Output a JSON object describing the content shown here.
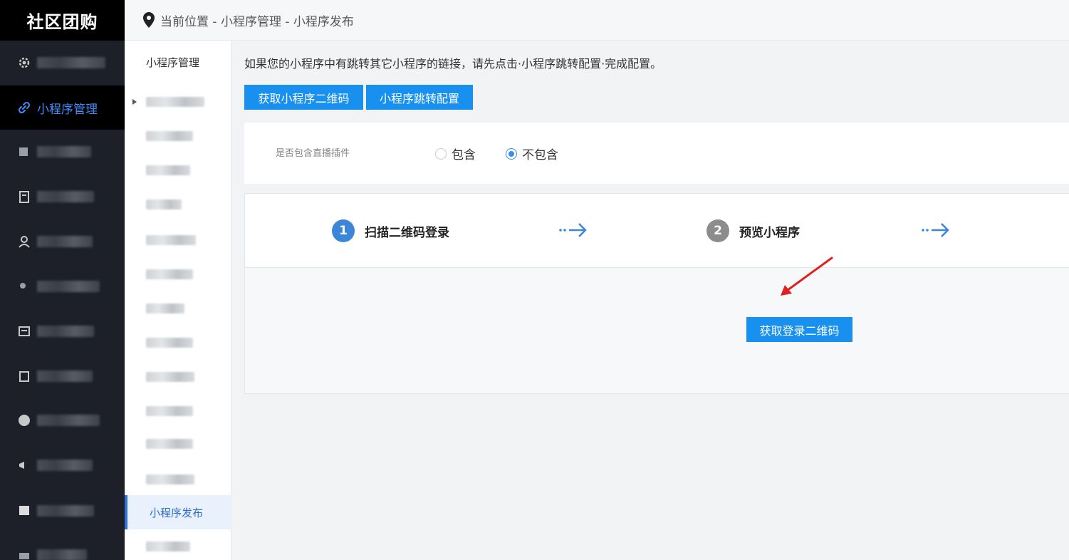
{
  "app": {
    "logo": "社区团购"
  },
  "breadcrumb": {
    "text": "当前位置 - 小程序管理 - 小程序发布"
  },
  "sidebar": {
    "items": [
      {
        "label": "",
        "icon": "gear-icon",
        "blurred": true
      },
      {
        "label": "小程序管理",
        "icon": "link-icon",
        "active": true
      },
      {
        "label": "",
        "icon": "layers-icon",
        "blurred": true
      },
      {
        "label": "",
        "icon": "document-icon",
        "blurred": true
      },
      {
        "label": "",
        "icon": "user-icon",
        "blurred": true
      },
      {
        "label": "",
        "icon": "users-icon",
        "blurred": true
      },
      {
        "label": "",
        "icon": "list-icon",
        "blurred": true
      },
      {
        "label": "",
        "icon": "box-icon",
        "blurred": true
      },
      {
        "label": "",
        "icon": "clock-icon",
        "blurred": true
      },
      {
        "label": "",
        "icon": "megaphone-icon",
        "blurred": true
      },
      {
        "label": "",
        "icon": "store-icon",
        "blurred": true
      },
      {
        "label": "",
        "icon": "folder-icon",
        "blurred": true
      }
    ]
  },
  "submenu": {
    "title": "小程序管理",
    "items": [
      {
        "label": "",
        "blurred": true,
        "has_caret": true
      },
      {
        "label": "",
        "blurred": true
      },
      {
        "label": "",
        "blurred": true
      },
      {
        "label": "",
        "blurred": true
      },
      {
        "label": "",
        "blurred": true
      },
      {
        "label": "",
        "blurred": true
      },
      {
        "label": "",
        "blurred": true
      },
      {
        "label": "",
        "blurred": true
      },
      {
        "label": "",
        "blurred": true
      },
      {
        "label": "",
        "blurred": true
      },
      {
        "label": "",
        "blurred": true
      },
      {
        "label": "",
        "blurred": true
      },
      {
        "label": "小程序发布",
        "active": true
      },
      {
        "label": "",
        "blurred": true
      }
    ]
  },
  "main": {
    "notice": "如果您的小程序中有跳转其它小程序的链接，请先点击·小程序跳转配置·完成配置。",
    "buttons": {
      "get_qrcode": "获取小程序二维码",
      "jump_config": "小程序跳转配置"
    },
    "plugin": {
      "label": "是否包含直播插件",
      "options": [
        {
          "label": "包含",
          "selected": false
        },
        {
          "label": "不包含",
          "selected": true
        }
      ]
    },
    "steps": [
      {
        "num": "1",
        "label": "扫描二维码登录",
        "color": "#3b86d8"
      },
      {
        "num": "2",
        "label": "预览小程序",
        "color": "#8c8c8c"
      }
    ],
    "login_button": "获取登录二维码"
  },
  "colors": {
    "accent": "#1890f0",
    "sidebar_bg": "#1d2029",
    "active_text": "#3f8cff",
    "annotation": "#e02020"
  }
}
